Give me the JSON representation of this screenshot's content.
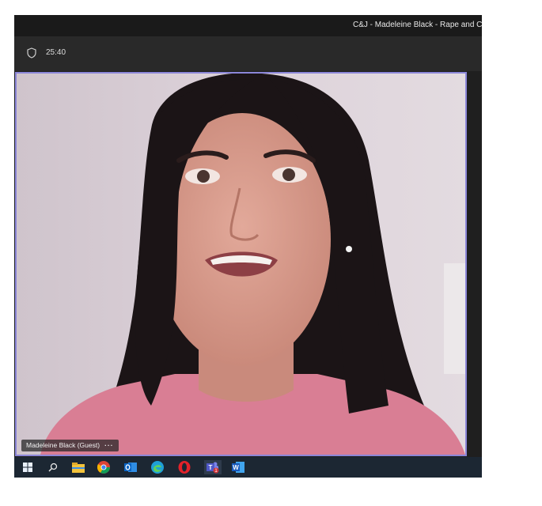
{
  "window": {
    "title": "C&J - Madeleine Black - Rape and Con"
  },
  "meeting": {
    "timer": "25:40",
    "status_icon": "shield-icon"
  },
  "video": {
    "participant_label": "Madeleine Black (Guest)",
    "more_label": "···",
    "active_speaker_color": "#8b86d8"
  },
  "taskbar": {
    "icons": [
      "windows-start-icon",
      "search-icon",
      "file-explorer-icon",
      "chrome-icon",
      "outlook-icon",
      "edge-icon",
      "opera-icon",
      "teams-icon",
      "word-icon"
    ],
    "teams_badge": "1"
  }
}
